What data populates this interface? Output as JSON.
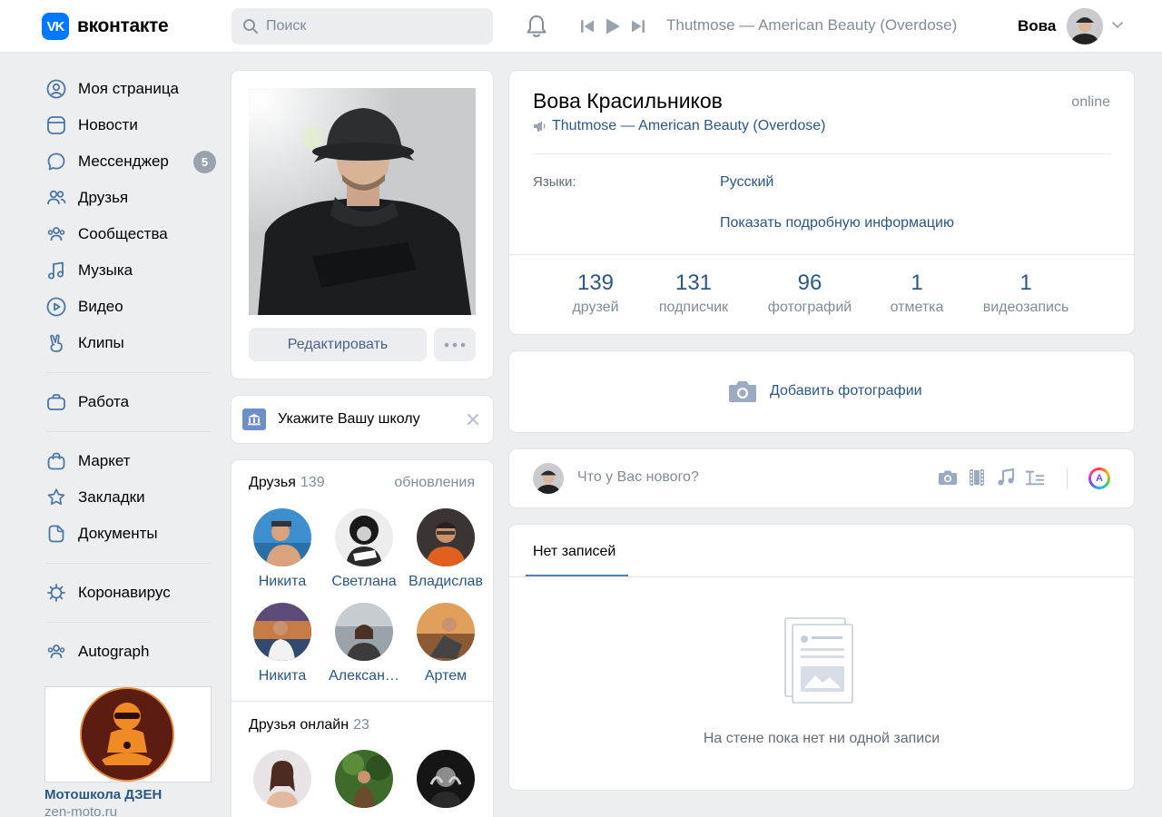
{
  "header": {
    "logo_mark": "VK",
    "logo_text": "вконтакте",
    "search_placeholder": "Поиск",
    "now_playing": "Thutmose — American Beauty (Overdose)",
    "user_name": "Вова"
  },
  "sidebar": {
    "items": [
      {
        "label": "Моя страница",
        "icon": "user-circle-icon"
      },
      {
        "label": "Новости",
        "icon": "news-icon"
      },
      {
        "label": "Мессенджер",
        "icon": "message-icon",
        "badge": "5"
      },
      {
        "label": "Друзья",
        "icon": "friends-icon"
      },
      {
        "label": "Сообщества",
        "icon": "communities-icon"
      },
      {
        "label": "Музыка",
        "icon": "music-icon"
      },
      {
        "label": "Видео",
        "icon": "video-icon"
      },
      {
        "label": "Клипы",
        "icon": "clips-icon"
      },
      {
        "label": "Работа",
        "icon": "work-icon"
      },
      {
        "label": "Маркет",
        "icon": "market-icon"
      },
      {
        "label": "Закладки",
        "icon": "bookmark-icon"
      },
      {
        "label": "Документы",
        "icon": "document-icon"
      },
      {
        "label": "Коронавирус",
        "icon": "virus-icon"
      },
      {
        "label": "Autograph",
        "icon": "communities-icon"
      }
    ],
    "ad": {
      "title": "Мотошкола ДЗЕН",
      "url": "zen-moto.ru"
    }
  },
  "profile_card": {
    "edit_button": "Редактировать"
  },
  "school_prompt": {
    "text": "Укажите Вашу школу"
  },
  "friends": {
    "title": "Друзья",
    "count": "139",
    "updates_link": "обновления",
    "list": [
      {
        "name": "Никита"
      },
      {
        "name": "Светлана"
      },
      {
        "name": "Владислав"
      },
      {
        "name": "Никита"
      },
      {
        "name": "Алексан…"
      },
      {
        "name": "Артем"
      }
    ],
    "online_title": "Друзья онлайн",
    "online_count": "23"
  },
  "profile": {
    "name": "Вова Красильников",
    "online_status": "online",
    "music_status": "Thutmose — American Beauty (Overdose)",
    "languages_label": "Языки:",
    "languages_value": "Русский",
    "more_info_link": "Показать подробную информацию",
    "counters": [
      {
        "value": "139",
        "label": "друзей"
      },
      {
        "value": "131",
        "label": "подписчик"
      },
      {
        "value": "96",
        "label": "фотографий"
      },
      {
        "value": "1",
        "label": "отметка"
      },
      {
        "value": "1",
        "label": "видеозапись"
      }
    ]
  },
  "add_photos": {
    "label": "Добавить фотографии"
  },
  "new_post": {
    "placeholder": "Что у Вас нового?",
    "color_badge": "A"
  },
  "wall": {
    "tab_label": "Нет записей",
    "empty_text": "На стене пока нет ни одной записи"
  },
  "colors": {
    "accent": "#0077ff",
    "link": "#2a5885",
    "muted": "#818c99",
    "background": "#edeef0"
  }
}
